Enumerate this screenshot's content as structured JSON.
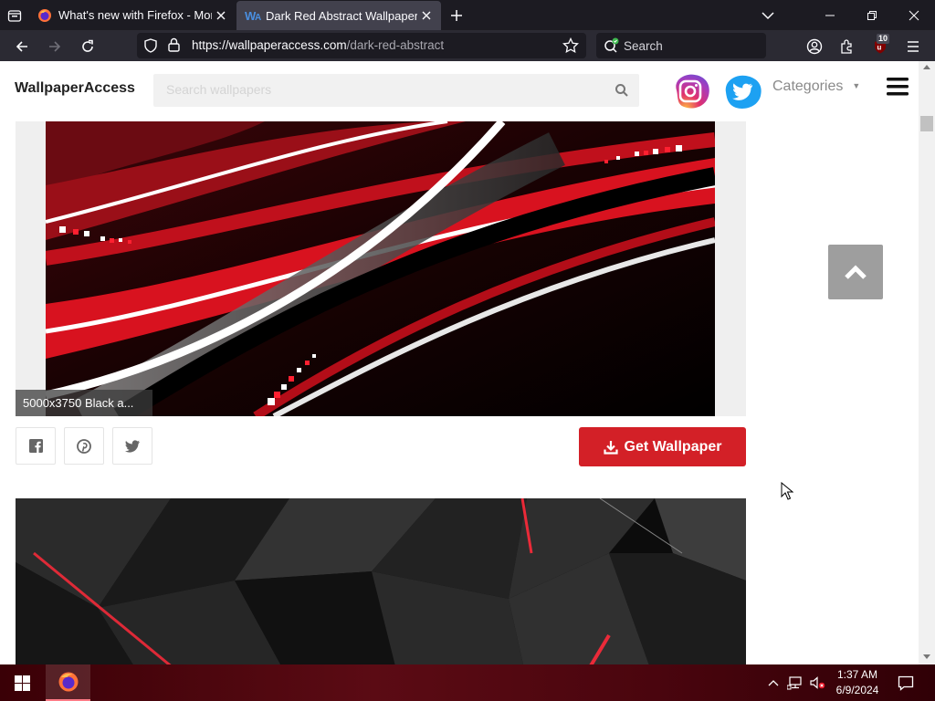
{
  "browser": {
    "tabs": [
      {
        "title": "What's new with Firefox - More"
      },
      {
        "title": "Dark Red Abstract Wallpapers -"
      }
    ],
    "url_host": "https://wallpaperaccess.com",
    "url_path": "/dark-red-abstract",
    "search_placeholder": "Search",
    "extension_badge": "10"
  },
  "site": {
    "brand": "WallpaperAccess",
    "search_placeholder": "Search wallpapers",
    "categories_label": "Categories",
    "categories_caret": "▼"
  },
  "content": {
    "caption": "5000x3750 Black a...",
    "get_button_label": "Get Wallpaper",
    "share_buttons": [
      "facebook-icon",
      "pinterest-icon",
      "twitter-icon"
    ]
  },
  "taskbar": {
    "time": "1:37 AM",
    "date": "6/9/2024"
  },
  "colors": {
    "accent_red": "#d32027",
    "browser_dark": "#1c1b22",
    "active_tab": "#42414d"
  }
}
